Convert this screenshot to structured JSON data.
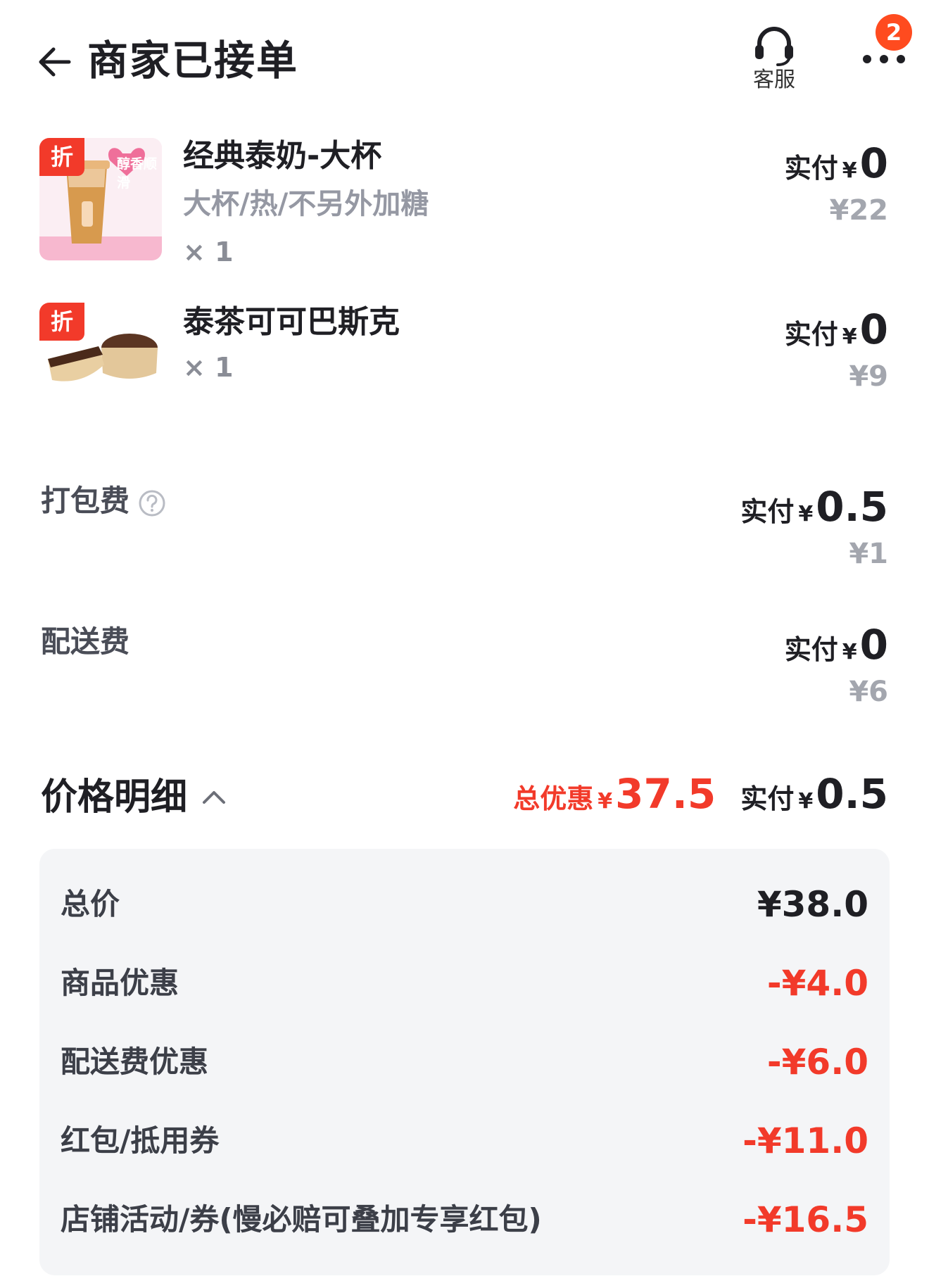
{
  "header": {
    "title": "商家已接单",
    "customer_service_label": "客服",
    "more_badge": "2"
  },
  "items": [
    {
      "tag": "折",
      "thumb_text": "醇香顺滑",
      "name": "经典泰奶-大杯",
      "spec": "大杯/热/不另外加糖",
      "qty": "× 1",
      "pay_label": "实付",
      "currency": "¥",
      "pay_amount": "0",
      "original_price": "¥22"
    },
    {
      "tag": "折",
      "name": "泰茶可可巴斯克",
      "qty": "× 1",
      "pay_label": "实付",
      "currency": "¥",
      "pay_amount": "0",
      "original_price": "¥9"
    }
  ],
  "fees": {
    "packing": {
      "label": "打包费",
      "pay_label": "实付",
      "currency": "¥",
      "pay_amount": "0.5",
      "original_price": "¥1"
    },
    "delivery": {
      "label": "配送费",
      "pay_label": "实付",
      "currency": "¥",
      "pay_amount": "0",
      "original_price": "¥6"
    }
  },
  "price_detail": {
    "title": "价格明细",
    "discount_label": "总优惠",
    "discount_currency": "¥",
    "discount_amount": "37.5",
    "pay_label": "实付",
    "pay_currency": "¥",
    "pay_amount": "0.5",
    "rows": [
      {
        "label": "总价",
        "value": "¥38.0"
      },
      {
        "label": "商品优惠",
        "value": "-¥4.0"
      },
      {
        "label": "配送费优惠",
        "value": "-¥6.0"
      },
      {
        "label": "红包/抵用券",
        "value": "-¥11.0"
      },
      {
        "label": "店铺活动/券(慢必赔可叠加专享红包)",
        "value": "-¥16.5"
      }
    ]
  },
  "colors": {
    "accent_red": "#f23a2a",
    "badge_orange": "#ff4b1f",
    "muted_gray": "#a3a6ae",
    "detail_bg": "#f4f5f7"
  }
}
